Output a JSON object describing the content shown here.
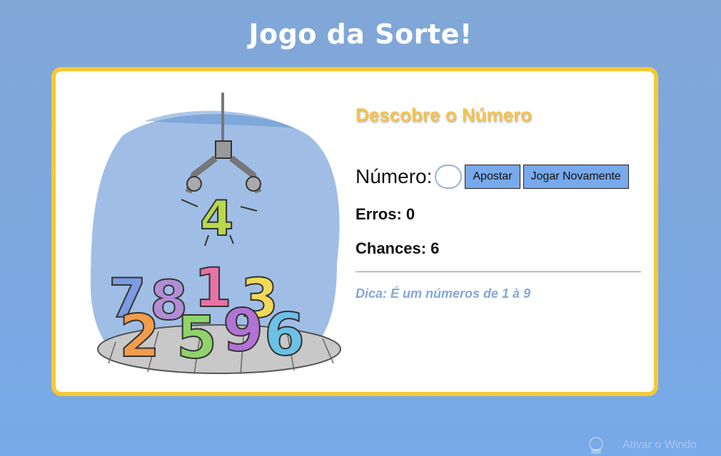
{
  "page": {
    "title": "Jogo da Sorte!"
  },
  "game": {
    "subtitle": "Descobre o Número",
    "number_label": "Número:",
    "number_value": "",
    "bet_button": "Apostar",
    "replay_button": "Jogar Novamente",
    "errors_text": "Erros: 0",
    "chances_text": "Chances: 6",
    "hint_text": "Dica: É um números de 1 à 9"
  },
  "illustration": {
    "held_digit": "4",
    "pile_digits_back": [
      "7",
      "8",
      "1",
      "3"
    ],
    "pile_digits_front": [
      "2",
      "5",
      "9",
      "6"
    ]
  },
  "watermark": {
    "text": "Ativar o Windo",
    "icon": "activate-icon"
  },
  "colors": {
    "background": "#7aa9e4",
    "card_border": "#f5c936",
    "subtitle": "#f6c445",
    "button": "#78a9eb",
    "hint": "#84a8d6"
  }
}
